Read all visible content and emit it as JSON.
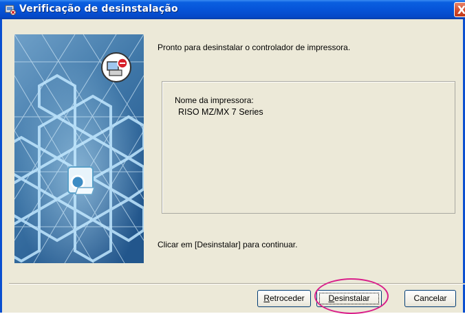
{
  "window": {
    "title": "Verificação de desinstalação",
    "close_glyph": "X",
    "title_icon": "installer-icon"
  },
  "content": {
    "message_top": "Pronto para desinstalar o controlador de impressora.",
    "printer_label": "Nome da impressora:",
    "printer_name": "RISO MZ/MX 7 Series",
    "message_bottom": "Clicar em [Desinstalar] para continuar."
  },
  "buttons": {
    "back_prefix": "",
    "back_mnemonic": "R",
    "back_rest": "etroceder",
    "uninstall_mnemonic": "D",
    "uninstall_rest": "esinstalar",
    "cancel_label": "Cancelar"
  },
  "colors": {
    "titlebar": "#0654d8",
    "panel_bg": "#ece9d8",
    "highlight": "#d91f8a"
  }
}
